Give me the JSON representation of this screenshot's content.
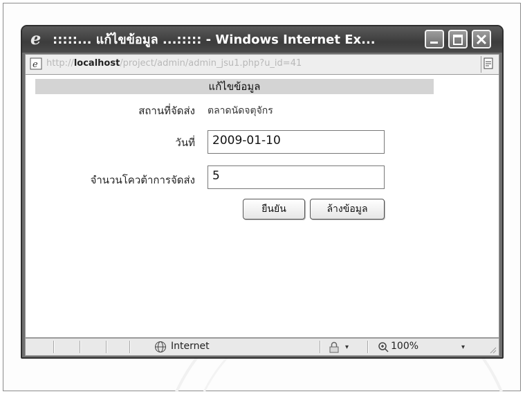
{
  "window": {
    "title": ":::::... แก้ไขข้อมูล ...::::: - Windows Internet Ex...",
    "buttons": {
      "minimize": "minimize-icon",
      "maximize": "maximize-icon",
      "close": "close-icon"
    }
  },
  "address": {
    "prefix": "http://",
    "host": "localhost",
    "path": "/project/admin/admin_jsu1.php?u_id=41"
  },
  "form": {
    "header": "แก้ไขข้อมูล",
    "fields": [
      {
        "label": "สถานที่จัดส่ง",
        "value": "ตลาดนัดจตุจักร"
      },
      {
        "label": "วันที่",
        "value": "2009-01-10"
      },
      {
        "label": "จำนวนโควต้าการจัดส่ง",
        "value": "5"
      }
    ],
    "submit_label": "ยืนยัน",
    "reset_label": "ล้างข้อมูล"
  },
  "status": {
    "zone": "Internet",
    "zoom": "100%",
    "caret": "▾"
  },
  "colors": {
    "titlebar": "#4a4a4a",
    "header_band": "#d4d4d4"
  }
}
